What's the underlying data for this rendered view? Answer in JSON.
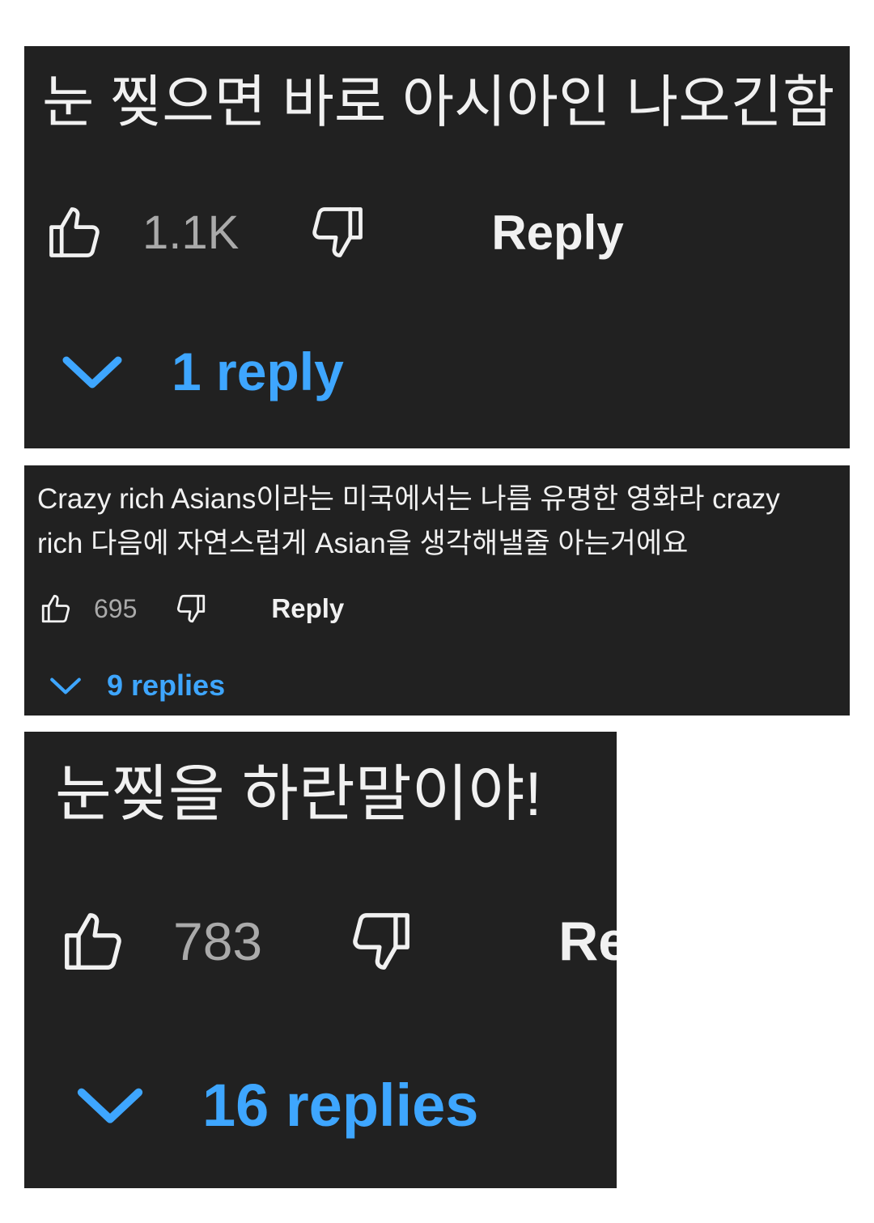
{
  "comments": [
    {
      "text_lines": [
        "눈 찢으면 바로 아시아인 나오긴함"
      ],
      "like_count": "1.1K",
      "reply_label": "Reply",
      "replies_label": "1 reply",
      "like_icon": "thumbs-up-icon",
      "dislike_icon": "thumbs-down-icon",
      "expand_icon": "chevron-down-icon"
    },
    {
      "text_lines": [
        "Crazy rich Asians이라는 미국에서는 나름 유명한 영화라 crazy",
        "rich 다음에 자연스럽게 Asian을 생각해낼줄 아는거에요"
      ],
      "like_count": "695",
      "reply_label": "Reply",
      "replies_label": "9 replies",
      "like_icon": "thumbs-up-icon",
      "dislike_icon": "thumbs-down-icon",
      "expand_icon": "chevron-down-icon"
    },
    {
      "text_lines": [
        "눈찢을 하란말이야!"
      ],
      "like_count": "783",
      "reply_label": "Reply",
      "replies_label": "16 replies",
      "like_icon": "thumbs-up-icon",
      "dislike_icon": "thumbs-down-icon",
      "expand_icon": "chevron-down-icon"
    }
  ],
  "colors": {
    "panel_background": "#212121",
    "page_background": "#ffffff",
    "text": "#f1f1f1",
    "count": "#aaaaaa",
    "link_blue": "#3ea6ff"
  }
}
